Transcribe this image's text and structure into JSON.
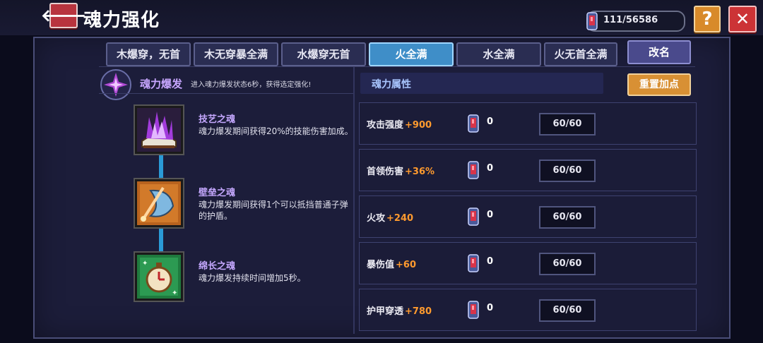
{
  "header": {
    "title": "魂力强化",
    "currency": "111/56586",
    "help_label": "?",
    "close_label": "✕",
    "back_icon": "back-arrow-icon"
  },
  "tabs": [
    {
      "label": "木爆穿，无首",
      "active": false
    },
    {
      "label": "木无穿暴全满",
      "active": false
    },
    {
      "label": "水爆穿无首",
      "active": false
    },
    {
      "label": "火全满",
      "active": true
    },
    {
      "label": "水全满",
      "active": false
    },
    {
      "label": "火无首全满",
      "active": false
    }
  ],
  "rename_label": "改名",
  "soul_burst": {
    "title": "魂力爆发",
    "description": "进入魂力爆发状态6秒，获得选定强化!"
  },
  "skills": [
    {
      "name": "技艺之魂",
      "desc": "魂力爆发期间获得20%的技能伤害加成。"
    },
    {
      "name": "壁垒之魂",
      "desc": "魂力爆发期间获得1个可以抵挡普通子弹的护盾。"
    },
    {
      "name": "绵长之魂",
      "desc": "魂力爆发持续时间增加5秒。"
    }
  ],
  "attributes": {
    "header": "魂力属性",
    "reset_label": "重置加点",
    "rows": [
      {
        "label": "攻击强度",
        "bonus": "+900",
        "count": "0",
        "value": "60/60"
      },
      {
        "label": "首领伤害",
        "bonus": "+36%",
        "count": "0",
        "value": "60/60"
      },
      {
        "label": "火攻",
        "bonus": "+240",
        "count": "0",
        "value": "60/60"
      },
      {
        "label": "暴伤值",
        "bonus": "+60",
        "count": "0",
        "value": "60/60"
      },
      {
        "label": "护甲穿透",
        "bonus": "+780",
        "count": "0",
        "value": "60/60"
      }
    ]
  },
  "colors": {
    "accent_orange": "#ff9a2e",
    "active_tab": "#3f8ec8",
    "skill_name": "#c5a8ff"
  }
}
